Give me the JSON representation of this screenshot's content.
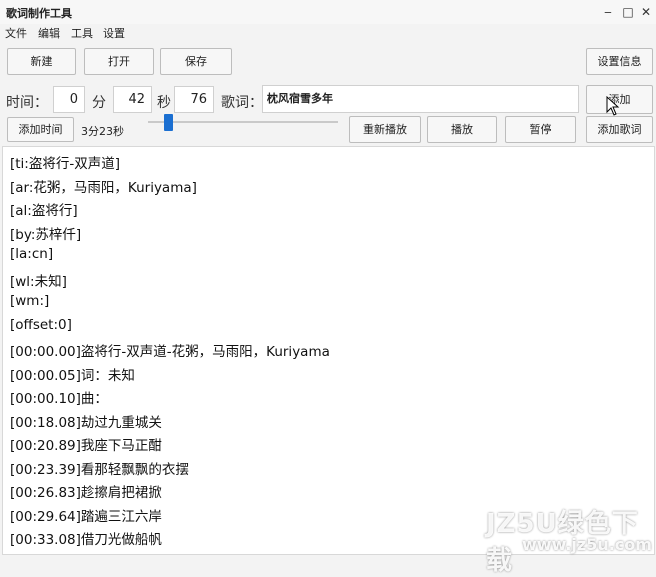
{
  "window": {
    "title": "歌词制作工具",
    "minimize": "‒",
    "maximize": "□",
    "close": "✕"
  },
  "menu": [
    "文件",
    "编辑",
    "工具",
    "设置"
  ],
  "toolbar": {
    "new": "新建",
    "open": "打开",
    "save": "保存",
    "settings_info": "设置信息"
  },
  "time": {
    "label": "时间：",
    "minutes_value": "0",
    "minutes_unit": "分",
    "seconds_value": "42",
    "seconds_unit": "秒",
    "centis_value": "76"
  },
  "lyric": {
    "label": "歌词：",
    "value": "枕风宿雪多年",
    "add": "添加"
  },
  "controls": {
    "add_time": "添加时间",
    "duration": "3分23秒",
    "replay": "重新播放",
    "play": "播放",
    "pause": "暂停",
    "add_lyric": "添加歌词"
  },
  "slider": {
    "position_fraction": 0.11
  },
  "lyrics_lines": [
    "[ti:盗将行-双声道]",
    "[ar:花粥，马雨阳，Kuriyama]",
    "[al:盗将行]",
    "[by:苏梓仟]",
    "[la:cn]",
    "[wl:未知]",
    "[wm:]",
    "[offset:0]",
    "[00:00.00]盗将行-双声道-花粥，马雨阳，Kuriyama",
    "[00:00.05]词：未知",
    "[00:00.10]曲：",
    "[00:18.08]劫过九重城关",
    "[00:20.89]我座下马正酣",
    "[00:23.39]看那轻飘飘的衣摆",
    "[00:26.83]趁擦肩把裙掀",
    "[00:29.64]踏遍三江六岸",
    "[00:33.08]借刀光做船帆"
  ],
  "watermark": {
    "brand": "JZ5U绿色下载",
    "url": "www.jz5u.com"
  }
}
